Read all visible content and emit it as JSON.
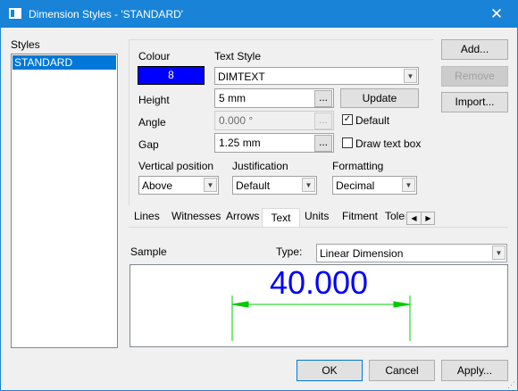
{
  "window": {
    "title": "Dimension Styles - 'STANDARD'",
    "close_glyph": "✕"
  },
  "styles": {
    "label": "Styles",
    "items": [
      "STANDARD"
    ]
  },
  "colour": {
    "label": "Colour",
    "value": "8",
    "swatch": "#0000ff"
  },
  "text_style": {
    "label": "Text Style",
    "value": "DIMTEXT"
  },
  "height": {
    "label": "Height",
    "value": "5 mm"
  },
  "angle": {
    "label": "Angle",
    "value": "0.000 °"
  },
  "gap": {
    "label": "Gap",
    "value": "1.25 mm"
  },
  "update_button": "Update",
  "default_checkbox": {
    "label": "Default",
    "checked": true
  },
  "draw_text_box": {
    "label": "Draw text box",
    "checked": false
  },
  "vertical_position": {
    "label": "Vertical position",
    "value": "Above"
  },
  "justification": {
    "label": "Justification",
    "value": "Default"
  },
  "formatting": {
    "label": "Formatting",
    "value": "Decimal"
  },
  "side_buttons": {
    "add": "Add...",
    "remove": "Remove",
    "import": "Import..."
  },
  "tabs": [
    "Lines",
    "Witnesses",
    "Arrows",
    "Text",
    "Units",
    "Fitment",
    "Toler"
  ],
  "active_tab": "Text",
  "sample": {
    "label": "Sample",
    "type_label": "Type:",
    "type_value": "Linear Dimension",
    "dimension_text": "40.000",
    "text_color": "#0000ff",
    "line_color": "#00cc00"
  },
  "footer": {
    "ok": "OK",
    "cancel": "Cancel",
    "apply": "Apply..."
  },
  "ellipsis": "...",
  "checkmark": "✓"
}
